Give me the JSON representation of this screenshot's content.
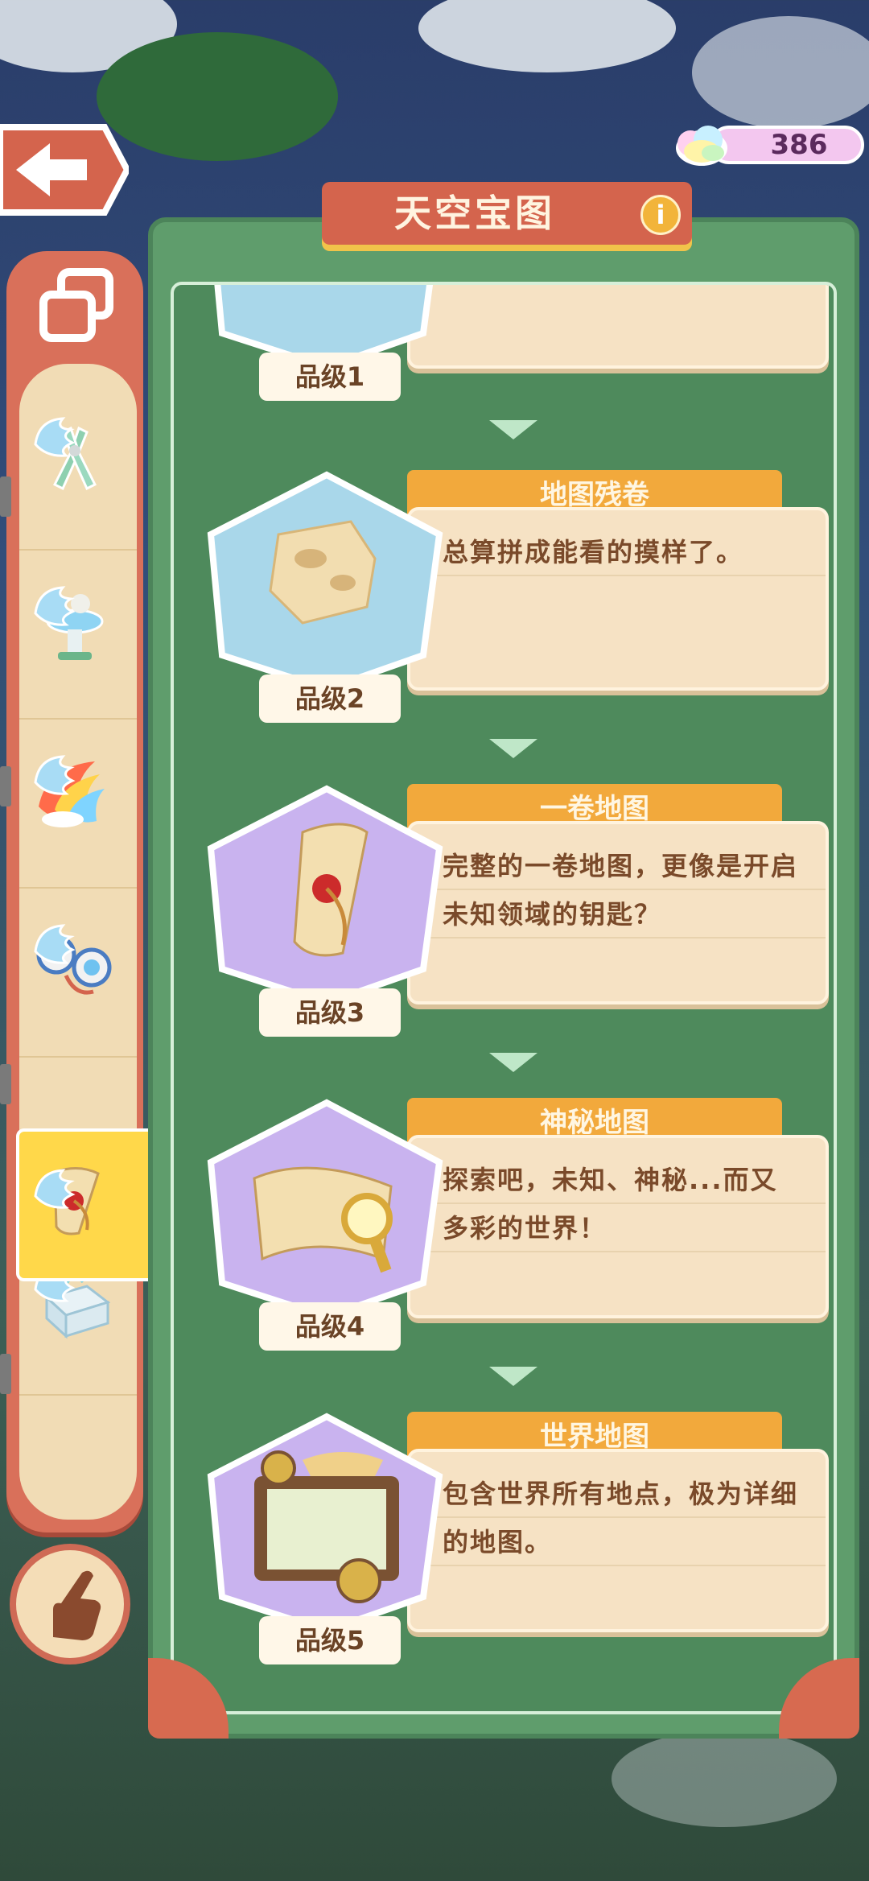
{
  "header": {
    "title": "天空宝图",
    "currency_value": "386"
  },
  "icons": {
    "back": "back-arrow-icon",
    "info": "info-icon",
    "currency": "rainbow-cloud-icon",
    "collection": "collection-icon",
    "hand": "pointing-hand-icon"
  },
  "sidebar": {
    "items": [
      {
        "name": "pliers-item",
        "icon": "pliers-icon"
      },
      {
        "name": "fountain-item",
        "icon": "fountain-icon"
      },
      {
        "name": "rainbow-item",
        "icon": "rainbow-icon"
      },
      {
        "name": "binoculars-item",
        "icon": "binoculars-icon"
      },
      {
        "name": "map-scroll-item",
        "icon": "map-scroll-icon",
        "active": true
      },
      {
        "name": "box-item",
        "icon": "box-icon"
      }
    ]
  },
  "grades": [
    {
      "grade_label": "品级1",
      "name": "",
      "desc": ""
    },
    {
      "grade_label": "品级2",
      "name": "地图残卷",
      "desc": "总算拼成能看的摸样了。"
    },
    {
      "grade_label": "品级3",
      "name": "一卷地图",
      "desc": "完整的一卷地图，更像是开启未知领域的钥匙？"
    },
    {
      "grade_label": "品级4",
      "name": "神秘地图",
      "desc": "探索吧，未知、神秘...而又多彩的世界！"
    },
    {
      "grade_label": "品级5",
      "name": "世界地图",
      "desc": "包含世界所有地点，极为详细的地图。"
    }
  ],
  "colors": {
    "panel_green": "#5f9d6c",
    "ribbon_red": "#d4644d",
    "name_orange": "#f2a93c",
    "desc_paper": "#f6e2c4",
    "hex_blue": "#a9d7ea",
    "hex_purple": "#c9b3ef"
  }
}
